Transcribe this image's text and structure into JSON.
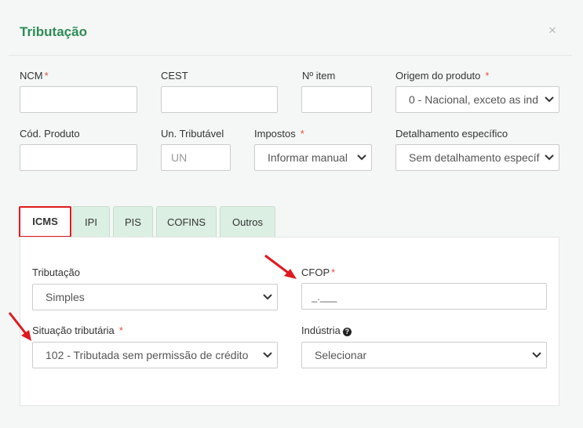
{
  "header": {
    "title": "Tributação",
    "close_symbol": "×"
  },
  "fields": {
    "ncm": {
      "label": "NCM",
      "required_mark": "*",
      "value": ""
    },
    "cest": {
      "label": "CEST",
      "value": ""
    },
    "item_no": {
      "label": "Nº item",
      "value": ""
    },
    "origem": {
      "label": "Origem do produto",
      "required_mark": "*",
      "selected": "0 - Nacional, exceto as ind"
    },
    "cod_produto": {
      "label": "Cód. Produto",
      "value": ""
    },
    "un_tributavel": {
      "label": "Un. Tributável",
      "placeholder": "UN"
    },
    "impostos": {
      "label": "Impostos",
      "required_mark": "*",
      "selected": "Informar manual"
    },
    "detalhamento": {
      "label": "Detalhamento específico",
      "selected": "Sem detalhamento específ"
    }
  },
  "tabs": [
    {
      "label": "ICMS",
      "active": true
    },
    {
      "label": "IPI",
      "active": false
    },
    {
      "label": "PIS",
      "active": false
    },
    {
      "label": "COFINS",
      "active": false
    },
    {
      "label": "Outros",
      "active": false
    }
  ],
  "icms": {
    "tributacao": {
      "label": "Tributação",
      "selected": "Simples"
    },
    "cfop": {
      "label": "CFOP",
      "required_mark": "*",
      "value": "_.___"
    },
    "situacao": {
      "label": "Situação tributária",
      "required_mark": "*",
      "selected": "102 - Tributada sem permissão de crédito"
    },
    "industria": {
      "label": "Indústria",
      "help_symbol": "?",
      "selected": "Selecionar"
    }
  },
  "colors": {
    "title_green": "#2e8b57",
    "required_red": "#e74c3c",
    "highlight_red": "#e0191e",
    "tab_green": "#dcefe3"
  },
  "annotations": [
    {
      "name": "red-arrow",
      "points_to": "CFOP"
    },
    {
      "name": "red-arrow",
      "points_to": "Situação tributária"
    }
  ]
}
